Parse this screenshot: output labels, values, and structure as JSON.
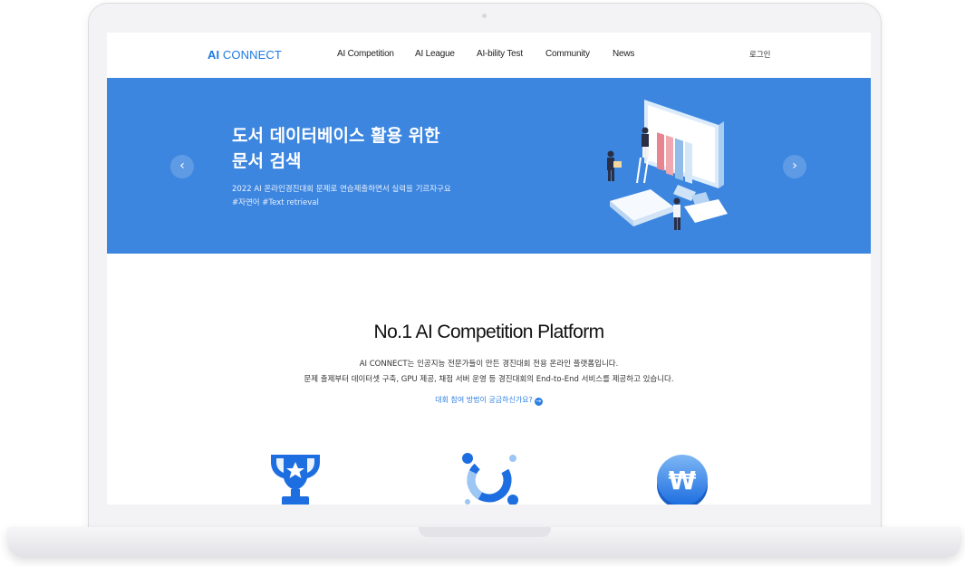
{
  "header": {
    "logo_bold": "AI",
    "logo_rest": " CONNECT",
    "nav": [
      "AI Competition",
      "AI League",
      "AI-bility Test",
      "Community",
      "News"
    ],
    "login": "로그인"
  },
  "hero": {
    "title": "도서 데이터베이스 활용 위한\n문서 검색",
    "subtitle": "2022 AI 온라인경진대회 문제로 연습제출하면서 실력을 기르자구요",
    "tags": "#자연어 #Text retrieval",
    "prev_icon": "chevron-left-icon",
    "next_icon": "chevron-right-icon",
    "accent_color": "#3c86e0"
  },
  "intro": {
    "title": "No.1 AI Competition Platform",
    "line1": "AI CONNECT는 인공지능 전문가들이 만든 경진대회 전용 온라인 플랫폼입니다.",
    "line2": "문제 출제부터 데이터셋 구축, GPU 제공, 채점 서버 운영 등 경진대회의 End-to-End 서비스를 제공하고 있습니다.",
    "link": "대회 참여 방법이 궁금하신가요?"
  },
  "features": [
    "trophy-icon",
    "connect-ring-icon",
    "won-coin-icon"
  ]
}
